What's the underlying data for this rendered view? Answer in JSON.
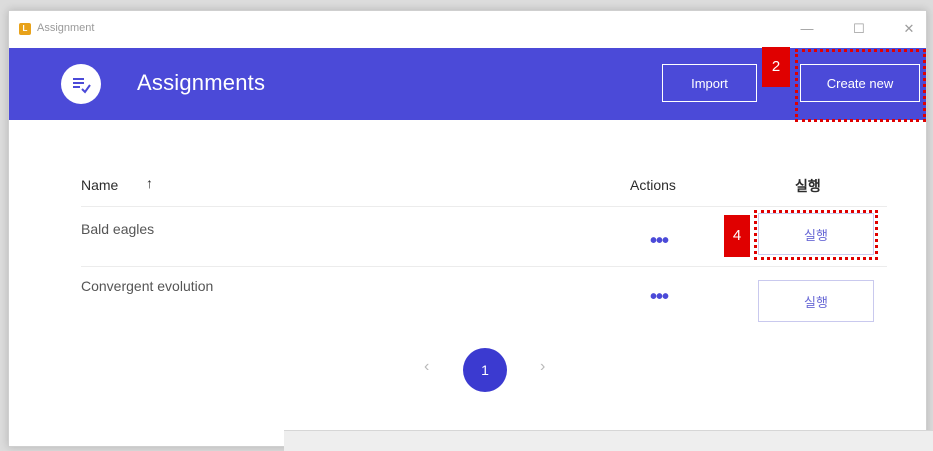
{
  "window": {
    "title": "Assignment",
    "controls": {
      "minimize": "—",
      "maximize": "☐",
      "close": "✕"
    }
  },
  "header": {
    "title": "Assignments",
    "import_label": "Import",
    "create_label": "Create new",
    "accent_color": "#4b4ad8"
  },
  "annotations": {
    "marker_create": "2",
    "marker_run": "4",
    "marker_color": "#e00000"
  },
  "table": {
    "headers": {
      "name": "Name",
      "sort": "↑",
      "actions": "Actions",
      "run": "실행"
    },
    "rows": [
      {
        "name": "Bald eagles",
        "actions": "•••",
        "run_label": "실행"
      },
      {
        "name": "Convergent evolution",
        "actions": "•••",
        "run_label": "실행"
      }
    ]
  },
  "pagination": {
    "prev": "‹",
    "current_page": "1",
    "next": "›"
  }
}
